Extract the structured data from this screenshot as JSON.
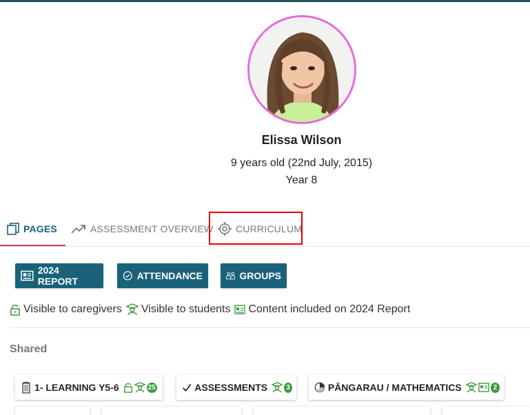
{
  "student": {
    "name": "Elissa Wilson",
    "age": "9 years old (22nd July, 2015)",
    "year": "Year 8"
  },
  "tabs": [
    {
      "label": "PAGES",
      "icon": "pages-icon",
      "active": true
    },
    {
      "label": "ASSESSMENT OVERVIEW",
      "icon": "trending-up-icon",
      "active": false
    },
    {
      "label": "CURRICULUM",
      "icon": "target-icon",
      "active": false
    }
  ],
  "buttons": [
    {
      "label": "2024 REPORT",
      "icon": "report-card-icon"
    },
    {
      "label": "ATTENDANCE",
      "icon": "check-circle-icon"
    },
    {
      "label": "GROUPS",
      "icon": "groups-icon"
    }
  ],
  "legend": [
    {
      "label": "Visible to caregivers",
      "icon": "lock-open-icon"
    },
    {
      "label": "Visible to students",
      "icon": "student-icon"
    },
    {
      "label": "Content included on 2024 Report",
      "icon": "report-card-icon"
    }
  ],
  "section_title": "Shared",
  "cards": [
    {
      "label": "1- LEARNING Y5-6",
      "icon": "notebook-icon",
      "badge": "25"
    },
    {
      "label": "ASSESSMENTS",
      "icon": "check-icon",
      "badge": "3"
    },
    {
      "label": "PĀNGARAU / MATHEMATICS",
      "icon": "pie-chart-icon",
      "badge": "2"
    }
  ],
  "colors": {
    "primary": "#19627a",
    "tab_active_underline": "#c9347a",
    "green": "#3d9a3d",
    "highlight": "#e00000",
    "avatar_border": "#e66ad9"
  }
}
